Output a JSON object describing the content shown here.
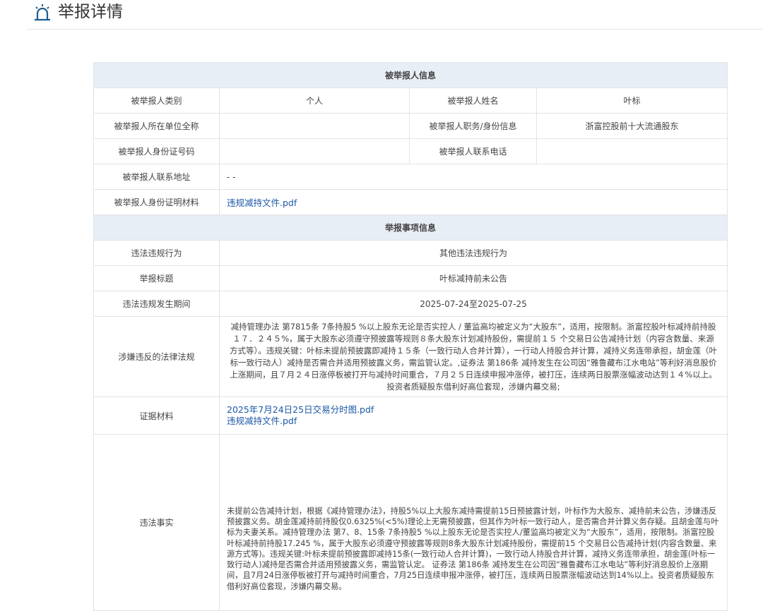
{
  "header": {
    "title": "举报详情",
    "icon": "alarm-bell-icon",
    "accent": "#1f5d8f"
  },
  "sections": {
    "reported": "被举报人信息",
    "matter": "举报事项信息"
  },
  "reported": {
    "type_label": "被举报人类别",
    "type_value": "个人",
    "name_label": "被举报人姓名",
    "name_value": "叶标",
    "org_label": "被举报人所在单位全称",
    "org_value": "",
    "position_label": "被举报人职务/身份信息",
    "position_value": "浙富控股前十大流通股东",
    "id_label": "被举报人身份证号码",
    "id_value": "",
    "phone_label": "被举报人联系电话",
    "phone_value": "",
    "address_label": "被举报人联系地址",
    "address_value": "- -",
    "proof_label": "被举报人身份证明材料",
    "proof_file": "违规减持文件.pdf"
  },
  "matter": {
    "behavior_label": "违法违规行为",
    "behavior_value": "其他违法违规行为",
    "subject_label": "举报标题",
    "subject_value": "叶标减持前未公告",
    "period_label": "违法违规发生期间",
    "period_value": "2025-07-24至2025-07-25",
    "law_label": "涉嫌违反的法律法规",
    "law_value": "减持管理办法 第7815条 7条持股5 %以上股东无论是否实控人 / 董监高均被定义为“大股东”，适用，按限制。浙富控股叶标减持前持股１７．２４５%，属于大股东必须遵守预披露等规则８条大股东计划减持股份，需提前１５ 个交易日公告减持计划（内容含数量、来源方式等）。违规关键：叶标未提前预披露即减持１５条（一致行动人合并计算），一行动人持股合并计算，减持义务连带承担，胡金莲（叶标一致行动人）减持是否需合并适用预披露义务，需监管认定。,证券法 第186条 减持发生在公司因“雅鲁藏布江水电站”等利好消息股价上涨期间，且７月２４日涨停板被打开与减持时间重合，７月２５日连续申报冲涨停，被打压，连续两日股票涨幅波动达到１４%以上。投资者质疑股东借利好高位套现，涉嫌内幕交易;",
    "evidence_label": "证据材料",
    "evidence_files": [
      "2025年7月24日25日交易分时图.pdf",
      "违规减持文件.pdf"
    ],
    "facts_label": "违法事实",
    "facts_value": "未提前公告减持计划，根据《减持管理办法》，持股5%以上大股东减持需提前15日预披露计划，叶标作为大股东、减持前未公告，涉嫌违反预披露义务。胡金莲减持前持股仅0.6325%(<5%)理论上无需预披露，但其作为叶标一致行动人，是否需合并计算义务存疑。且胡金莲与叶标为夫妻关系。减持管理办法 第7、8、15条 7条持股5 %以上股东无论是否实控人/董监高均被定义为“大股东”，适用，按限制。浙富控股叶标减持前持股17.245 %，属于大股东必须遵守预披露等规则8条大股东计划减持股份，需提前15 个交易日公告减持计划(内容含数量、来源方式等)。违规关键:叶标未提前预披露即减持15条(一致行动人合并计算)，一致行动人持股合并计算，减持义务连带承担，胡金莲(叶标一致行动人)减持是否需合并适用预披露义务，需监管认定。 证券法 第186条 减持发生在公司因“雅鲁藏布江水电站”等利好消息股价上涨期间，且7月24日涨停板被打开与减持时间重合，7月25日连续申报冲涨停，被打压，连续两日股票涨幅波动达到14%以上。投资者质疑股东借利好高位套现，涉嫌内幕交易。"
  }
}
